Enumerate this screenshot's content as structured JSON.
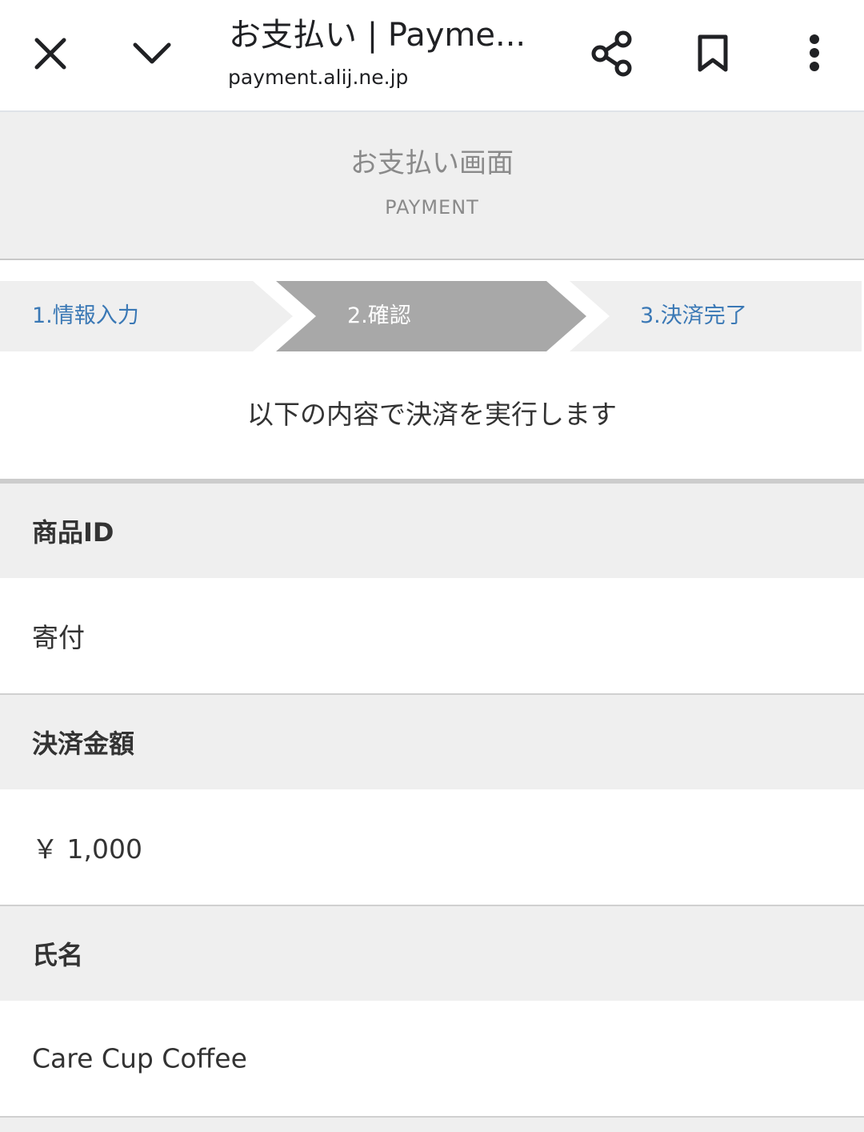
{
  "browser": {
    "title": "お支払い | Payme...",
    "url": "payment.alij.ne.jp",
    "icons": [
      "close-icon",
      "chevron-down-icon",
      "share-icon",
      "bookmark-icon",
      "more-vert-icon"
    ]
  },
  "header": {
    "title_jp": "お支払い画面",
    "title_en": "PAYMENT"
  },
  "steps": [
    {
      "label": "1.情報入力",
      "active": false
    },
    {
      "label": "2.確認",
      "active": true
    },
    {
      "label": "3.決済完了",
      "active": false
    }
  ],
  "colors": {
    "step_active": "#a8a8a8",
    "step_inactive": "#efefef",
    "step_text": "#3a78b5",
    "label_bg": "#efefef"
  },
  "confirm_message": "以下の内容で決済を実行します",
  "fields": [
    {
      "label": "商品ID",
      "value": "寄付"
    },
    {
      "label": "決済金額",
      "value": "￥ 1,000"
    },
    {
      "label": "氏名",
      "value": "Care Cup Coffee"
    }
  ]
}
